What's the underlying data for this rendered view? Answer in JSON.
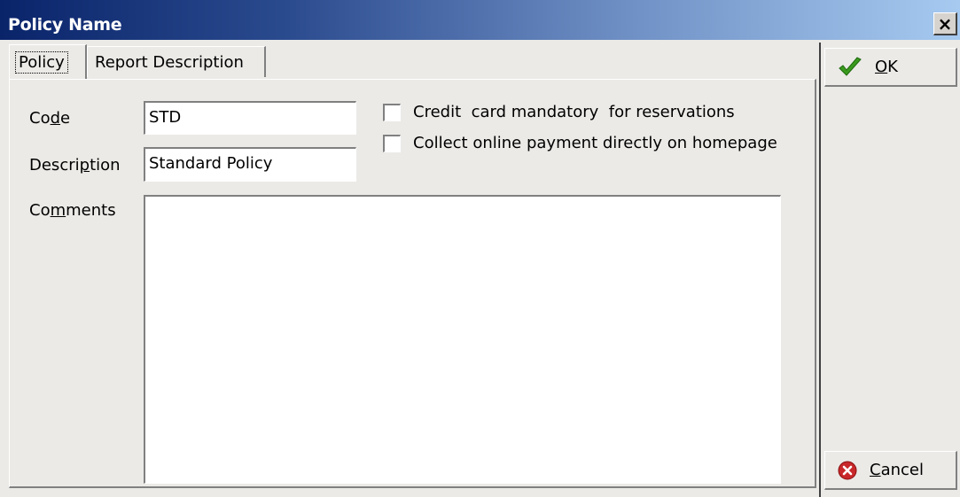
{
  "window": {
    "title": "Policy Name",
    "close_label": "×"
  },
  "tabs": [
    {
      "label": "Policy",
      "active": true
    },
    {
      "label": "Report Description",
      "active": false
    }
  ],
  "form": {
    "code": {
      "label_pre": "Co",
      "label_accel": "d",
      "label_post": "e",
      "value": "STD"
    },
    "description": {
      "label_pre": "Descri",
      "label_accel": "p",
      "label_post": "tion",
      "value": "Standard Policy"
    },
    "comments": {
      "label_pre": "Co",
      "label_accel": "m",
      "label_post": "ments",
      "value": ""
    },
    "checkboxes": [
      {
        "label": "Credit  card mandatory  for reservations",
        "checked": false
      },
      {
        "label": "Collect online payment directly on homepage",
        "checked": false
      }
    ]
  },
  "actions": {
    "ok": {
      "label_accel": "O",
      "label_post": "K",
      "icon": "checkmark-icon",
      "icon_color": "#3a9a1e"
    },
    "cancel": {
      "label_accel": "C",
      "label_post": "ancel",
      "icon": "cancel-icon",
      "icon_color": "#c8282a"
    }
  }
}
